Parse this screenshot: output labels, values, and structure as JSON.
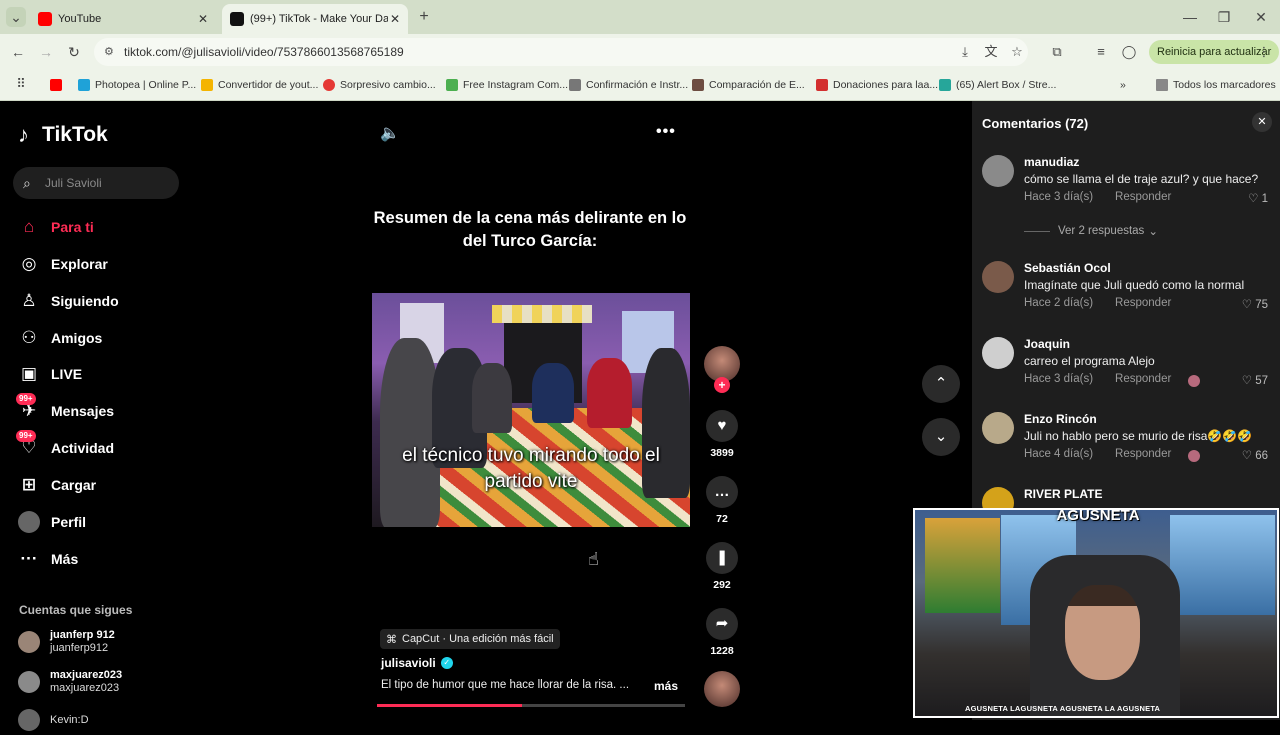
{
  "browser": {
    "tabs": [
      {
        "title": "YouTube",
        "close": "✕"
      },
      {
        "title": "(99+) TikTok - Make Your Da",
        "close": "✕"
      }
    ],
    "new_tab": "+",
    "url": "tiktok.com/@julisavioli/video/7537866013568765189",
    "update_button": "Reinicia para actualizar",
    "bookmarks": [
      {
        "label": "Photopea | Online P...",
        "color": "#1fa2d8"
      },
      {
        "label": "Convertidor de yout...",
        "color": "#f4b400"
      },
      {
        "label": "Sorpresivo cambio...",
        "color": "#e53935"
      },
      {
        "label": "Free Instagram Com...",
        "color": "#4caf50"
      },
      {
        "label": "Confirmación e Instr...",
        "color": "#777777"
      },
      {
        "label": "Comparación de E...",
        "color": "#6d4c41"
      },
      {
        "label": "Donaciones para laa...",
        "color": "#d32f2f"
      },
      {
        "label": "(65) Alert Box / Stre...",
        "color": "#26a69a"
      }
    ],
    "all_bookmarks": "Todos los marcadores"
  },
  "sidebar": {
    "logo": "TikTok",
    "search_placeholder": "Juli Savioli",
    "items": [
      {
        "label": "Para ti",
        "icon": "home-icon"
      },
      {
        "label": "Explorar",
        "icon": "compass-icon"
      },
      {
        "label": "Siguiendo",
        "icon": "following-icon"
      },
      {
        "label": "Amigos",
        "icon": "friends-icon"
      },
      {
        "label": "LIVE",
        "icon": "live-icon"
      },
      {
        "label": "Mensajes",
        "icon": "messages-icon",
        "badge": "99+"
      },
      {
        "label": "Actividad",
        "icon": "activity-icon",
        "badge": "99+"
      },
      {
        "label": "Cargar",
        "icon": "upload-icon"
      },
      {
        "label": "Perfil",
        "icon": "profile-icon"
      },
      {
        "label": "Más",
        "icon": "more-icon"
      }
    ],
    "following_title": "Cuentas que sigues",
    "following": [
      {
        "name": "juanferp 912",
        "handle": "juanferp912"
      },
      {
        "name": "maxjuarez023",
        "handle": "maxjuarez023"
      },
      {
        "name": "Kevin:D",
        "handle": ""
      }
    ]
  },
  "video": {
    "title": "Resumen de la cena más delirante en lo del Turco García:",
    "caption": "el técnico tuvo mirando todo el partido vite",
    "likes": "3899",
    "comments": "72",
    "saves": "292",
    "shares": "1228",
    "capcut": "CapCut · Una edición más fácil",
    "author": "julisavioli",
    "description": "El tipo de humor que me hace llorar de la risa. ...",
    "more": "más",
    "progress": 0.47
  },
  "comments": {
    "header": "Comentarios (72)",
    "items": [
      {
        "user": "manudiaz",
        "text": "cómo se llama el de traje azul? y que hace?",
        "time": "Hace 3 día(s)",
        "reply": "Responder",
        "likes": "1",
        "avatar": "#8a8a8a"
      },
      {
        "user": "Sebastián Ocol",
        "text": "Imagínate que Juli quedó como la normal",
        "time": "Hace 2 día(s)",
        "reply": "Responder",
        "likes": "75",
        "avatar": "#7a5a4a"
      },
      {
        "user": "Joaquin",
        "text": "carreo el programa Alejo",
        "time": "Hace 3 día(s)",
        "reply": "Responder",
        "likes": "57",
        "avatar": "#cfcfcf"
      },
      {
        "user": "Enzo Rincón",
        "text": "Juli no hablo pero se murio de risa🤣🤣🤣",
        "time": "Hace 4 día(s)",
        "reply": "Responder",
        "likes": "66",
        "avatar": "#b8a98a"
      },
      {
        "user": "RIVER PLATE",
        "text": "",
        "time": "",
        "reply": "",
        "likes": "",
        "avatar": "#d4a21a"
      }
    ],
    "replies_toggle": "Ver 2 respuestas"
  },
  "webcam": {
    "logo": "AGUSNETA",
    "footer": "AGUSNETA   LAGUSNETA   AGUSNETA   LA AGUSNETA"
  }
}
